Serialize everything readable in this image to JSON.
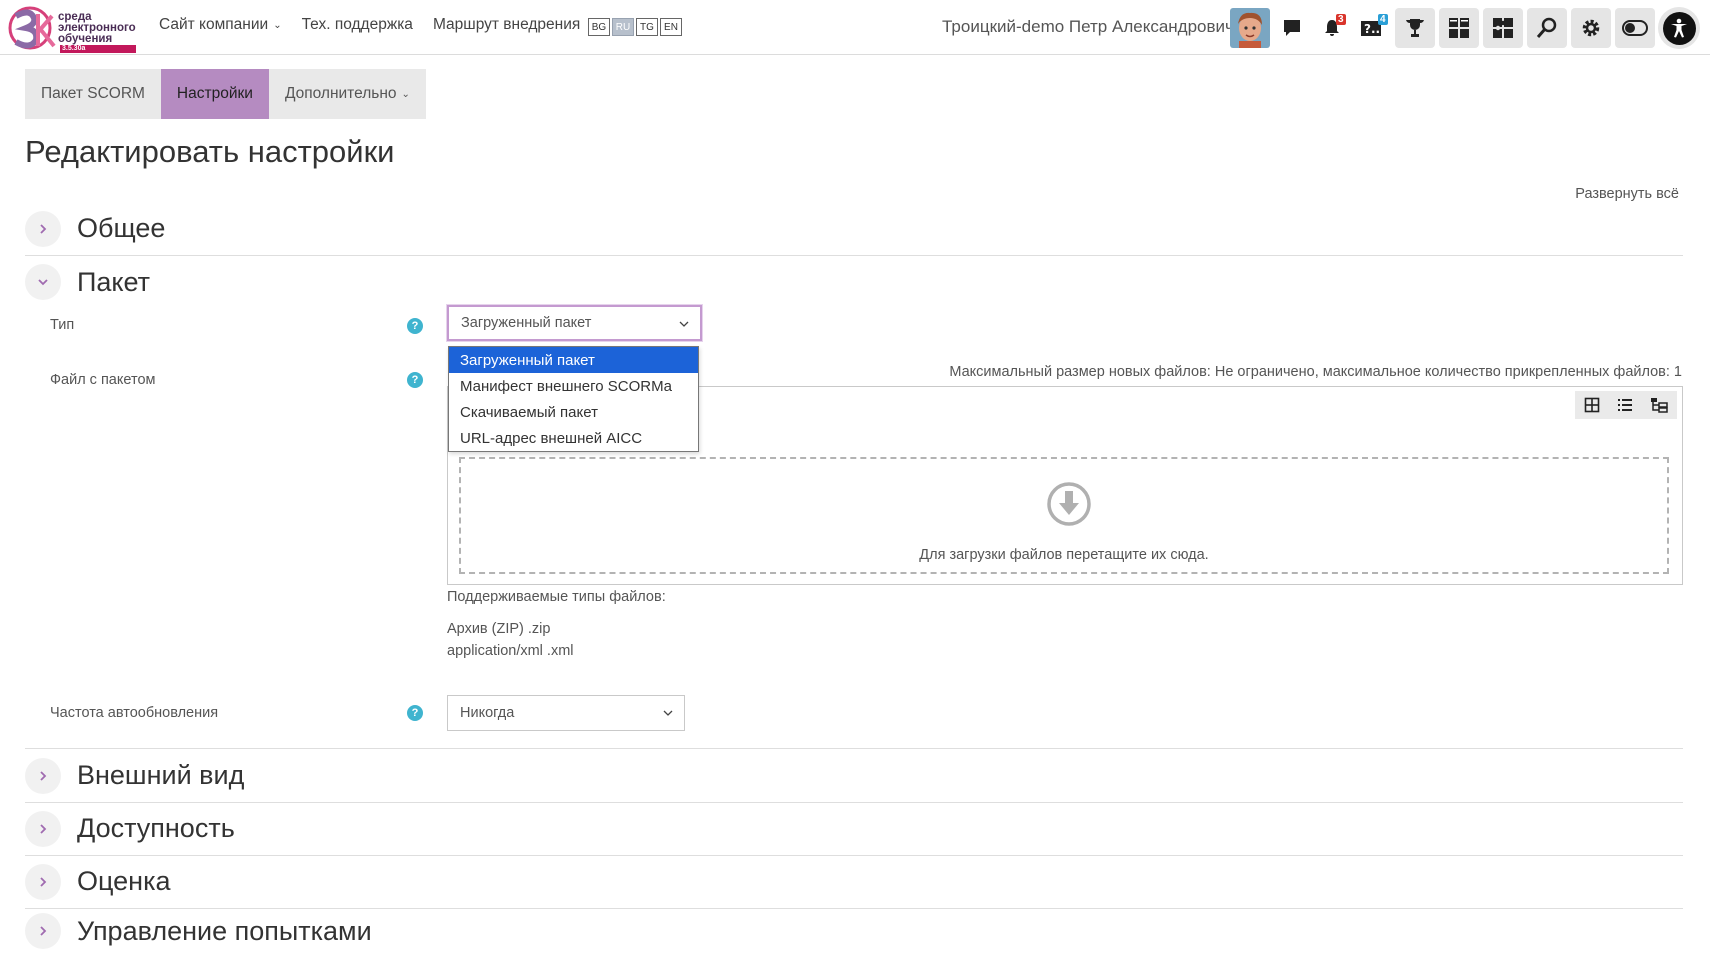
{
  "navbar": {
    "logo_text": [
      "среда",
      "электронного",
      "обучения"
    ],
    "logo_badge": "3.5.30a",
    "links": [
      {
        "label": "Сайт компании",
        "has_caret": true
      },
      {
        "label": "Тех. поддержка",
        "has_caret": false
      },
      {
        "label": "Маршрут внедрения",
        "has_caret": false
      }
    ],
    "languages": [
      "BG",
      "RU",
      "TG",
      "EN"
    ],
    "active_language": "RU",
    "user_name": "Троицкий-demo Петр Александрович",
    "notifications_count": "3",
    "questions_count": "4",
    "colors": {
      "accent": "#b58bc1",
      "badge_red": "#d9342b",
      "badge_blue": "#2a9fd6",
      "help": "#3fb4cf"
    }
  },
  "tabs": [
    {
      "label": "Пакет SCORM",
      "active": false
    },
    {
      "label": "Настройки",
      "active": true
    },
    {
      "label": "Дополнительно",
      "active": false,
      "has_caret": true
    }
  ],
  "page_title": "Редактировать настройки",
  "expand_all": "Развернуть всё",
  "sections": {
    "general": {
      "title": "Общее",
      "open": false
    },
    "package": {
      "title": "Пакет",
      "open": true
    },
    "appearance": {
      "title": "Внешний вид",
      "open": false
    },
    "availability": {
      "title": "Доступность",
      "open": false
    },
    "grade": {
      "title": "Оценка",
      "open": false
    },
    "attempts": {
      "title": "Управление попытками",
      "open": false
    }
  },
  "form": {
    "type": {
      "label": "Тип",
      "value": "Загруженный пакет",
      "options": [
        "Загруженный пакет",
        "Манифест внешнего SCORMa",
        "Скачиваемый пакет",
        "URL-адрес внешней AICC"
      ],
      "selected_index": 0
    },
    "package_file": {
      "label": "Файл с пакетом",
      "max_size_note": "Максимальный размер новых файлов: Не ограничено, максимальное количество прикрепленных файлов: 1",
      "dropzone_text": "Для загрузки файлов перетащите их сюда.",
      "supported_title": "Поддерживаемые типы файлов:",
      "supported_types": [
        "Архив (ZIP) .zip",
        "application/xml .xml"
      ]
    },
    "update_frequency": {
      "label": "Частота автообновления",
      "value": "Никогда"
    }
  }
}
